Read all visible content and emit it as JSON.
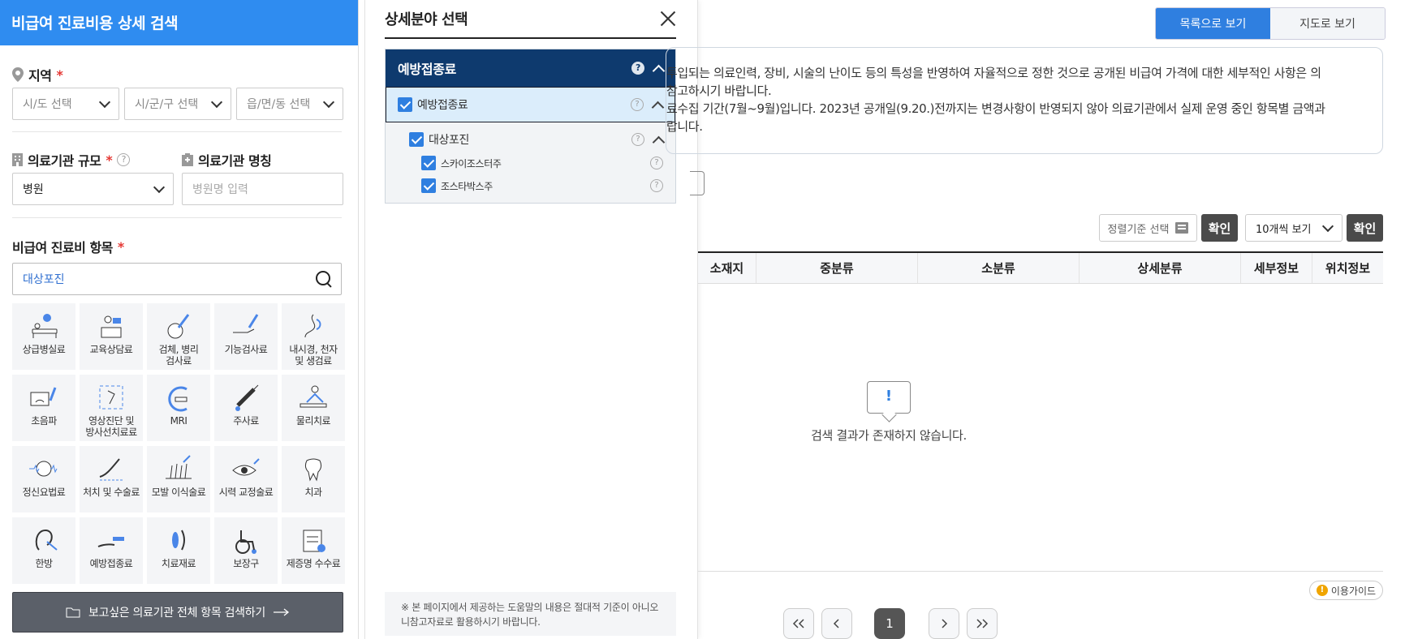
{
  "left_panel": {
    "title": "비급여 진료비용 상세 검색",
    "region": {
      "label": "지역",
      "required_mark": "*",
      "sido_placeholder": "시/도 선택",
      "sigungu_placeholder": "시/군/구 선택",
      "eupmyeondong_placeholder": "읍/면/동 선택"
    },
    "institution_scale": {
      "label": "의료기관 규모",
      "required_mark": "*",
      "help": "?",
      "selected": "병원"
    },
    "institution_name": {
      "label": "의료기관 명칭",
      "placeholder": "병원명 입력"
    },
    "items": {
      "label": "비급여 진료비 항목",
      "required_mark": "*",
      "search_value": "대상포진"
    },
    "categories": [
      {
        "label": "상급병실료",
        "icon": "hospital-bed-icon"
      },
      {
        "label": "교육상담료",
        "icon": "consultation-desk-icon"
      },
      {
        "label": "검체, 병리\n검사료",
        "icon": "lab-test-icon"
      },
      {
        "label": "기능검사료",
        "icon": "function-test-icon"
      },
      {
        "label": "내시경, 천자\n및 생검료",
        "icon": "endoscope-icon"
      },
      {
        "label": "초음파",
        "icon": "ultrasound-icon"
      },
      {
        "label": "영상진단 및\n방사선치료료",
        "icon": "xray-icon"
      },
      {
        "label": "MRI",
        "icon": "mri-icon"
      },
      {
        "label": "주사료",
        "icon": "syringe-icon"
      },
      {
        "label": "물리치료",
        "icon": "physical-therapy-icon"
      },
      {
        "label": "정신요법료",
        "icon": "brain-icon"
      },
      {
        "label": "처치 및 수술료",
        "icon": "scalpel-icon"
      },
      {
        "label": "모발 이식술료",
        "icon": "hair-transplant-icon"
      },
      {
        "label": "시력 교정술료",
        "icon": "eye-icon"
      },
      {
        "label": "치과",
        "icon": "tooth-icon"
      },
      {
        "label": "한방",
        "icon": "acupuncture-ear-icon"
      },
      {
        "label": "예방접종료",
        "icon": "vaccination-icon"
      },
      {
        "label": "치료재료",
        "icon": "treatment-material-icon"
      },
      {
        "label": "보장구",
        "icon": "wheelchair-icon"
      },
      {
        "label": "제증명 수수료",
        "icon": "certificate-icon"
      }
    ],
    "bottom_button": "보고싶은 의료기관 전체 항목 검색하기"
  },
  "popup": {
    "title": "상세분야 선택",
    "group_header": "예방접종료",
    "help": "?",
    "level1": "예방접종료",
    "level2": "대상포진",
    "level3": [
      "스카이조스터주",
      "조스타박스주"
    ],
    "note": "※ 본 페이지에서 제공하는 도움말의 내용은 절대적 기준이 아니오니참고자료로 활용하시기 바랍니다."
  },
  "main": {
    "view_list": "목록으로 보기",
    "view_map": "지도로 보기",
    "notice_lines": [
      "투입되는 의료인력, 장비, 시술의 난이도 등의 특성을 반영하여 자율적으로 정한 것으로 공개된 비급여 가격에 대한 세부적인 사항은 의",
      "참고하시기 바랍니다.",
      "료수집 기간(7월~9월)입니다. 2023년 공개일(9.20.)전까지는 변경사항이 반영되지 않아 의료기관에서 실제 운영 중인 항목별 금액과",
      "랍니다."
    ],
    "sort_label": "정렬기준 선택",
    "confirm": "확인",
    "count_selected": "10개씩 보기",
    "columns": [
      "소재지",
      "중분류",
      "소분류",
      "상세분류",
      "세부정보",
      "위치정보"
    ],
    "empty_icon": "!",
    "empty_message": "검색 결과가 존재하지 않습니다.",
    "guide_icon": "!",
    "guide_label": "이용가이드",
    "current_page": "1",
    "colors": {
      "primary": "#2f8cf0",
      "popup_header": "#0e3a6e",
      "button_dark": "#4a4a4a"
    }
  }
}
